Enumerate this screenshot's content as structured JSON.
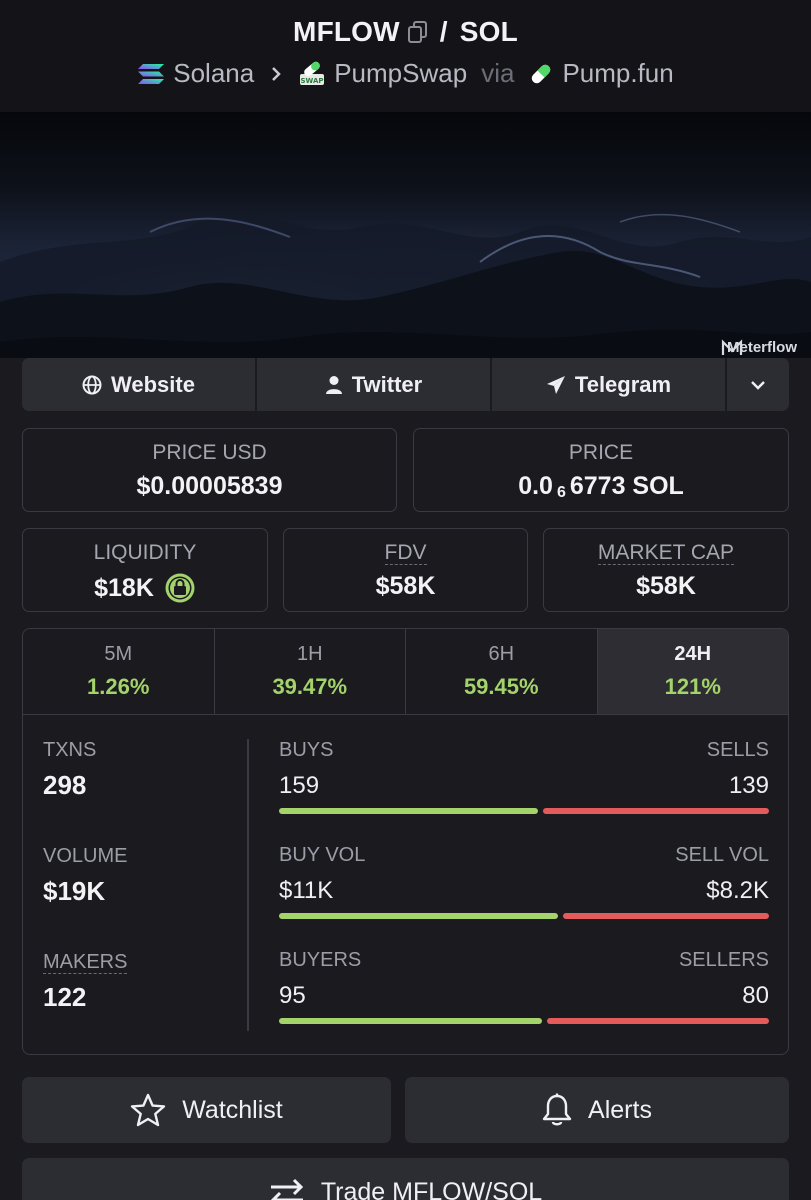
{
  "header": {
    "base_token": "MFLOW",
    "quote_token": "SOL",
    "separator": "/",
    "chain": "Solana",
    "dex": "PumpSwap",
    "via": "via",
    "launchpad": "Pump.fun",
    "dex_badge_text": "SWAP"
  },
  "banner": {
    "watermark": "Meterflow"
  },
  "links": [
    {
      "label": "Website",
      "icon": "globe-icon"
    },
    {
      "label": "Twitter",
      "icon": "person-icon"
    },
    {
      "label": "Telegram",
      "icon": "paper-plane-icon"
    },
    {
      "label": "",
      "icon": "chevron-down-icon"
    }
  ],
  "price": {
    "usd_label": "PRICE USD",
    "usd_value": "$0.00005839",
    "native_label": "PRICE",
    "native_prefix": "0.0",
    "native_zeros": "6",
    "native_digits": "6773 SOL"
  },
  "metrics": {
    "liquidity_label": "LIQUIDITY",
    "liquidity_value": "$18K",
    "fdv_label": "FDV",
    "fdv_value": "$58K",
    "mcap_label": "MARKET CAP",
    "mcap_value": "$58K"
  },
  "tabs": [
    {
      "label": "5M",
      "change": "1.26%"
    },
    {
      "label": "1H",
      "change": "39.47%"
    },
    {
      "label": "6H",
      "change": "59.45%"
    },
    {
      "label": "24H",
      "change": "121%",
      "active": true
    }
  ],
  "stats": {
    "txns_label": "TXNS",
    "txns_value": "298",
    "volume_label": "VOLUME",
    "volume_value": "$19K",
    "makers_label": "MAKERS",
    "makers_value": "122",
    "buys_label": "BUYS",
    "buys_value": "159",
    "sells_label": "SELLS",
    "sells_value": "139",
    "buys_fraction": 0.534,
    "buyvol_label": "BUY VOL",
    "buyvol_value": "$11K",
    "sellvol_label": "SELL VOL",
    "sellvol_value": "$8.2K",
    "buyvol_fraction": 0.576,
    "buyers_label": "BUYERS",
    "buyers_value": "95",
    "sellers_label": "SELLERS",
    "sellers_value": "80",
    "buyers_fraction": 0.543
  },
  "actions": {
    "watchlist_label": "Watchlist",
    "alerts_label": "Alerts",
    "trade_label": "Trade MFLOW/SOL"
  },
  "colors": {
    "positive": "#a3d36a",
    "negative": "#e35b5b",
    "background": "#1a1a1f",
    "panel": "#2c2c33"
  }
}
